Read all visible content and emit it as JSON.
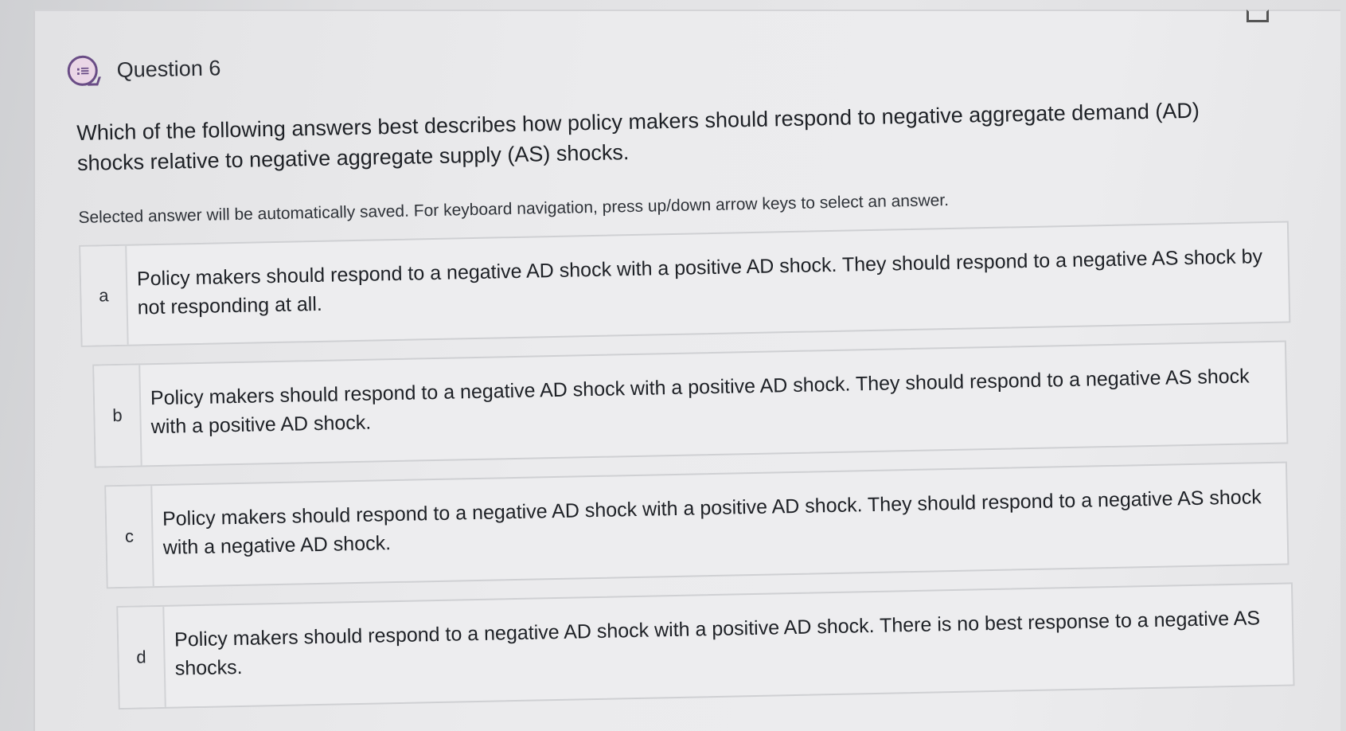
{
  "question": {
    "title": "Question 6",
    "icon": "list-bubble-icon",
    "text": "Which of the following answers best describes how policy makers should respond to negative aggregate demand (AD) shocks relative to negative aggregate supply (AS) shocks.",
    "hint": "Selected answer will be automatically saved. For keyboard navigation, press up/down arrow keys to select an answer."
  },
  "choices": [
    {
      "letter": "a",
      "text": "Policy makers should respond to a negative AD shock with a positive AD shock. They should respond to a negative AS shock by not responding at all."
    },
    {
      "letter": "b",
      "text": "Policy makers should respond to a negative AD shock with a positive AD shock. They should respond to a negative AS shock with a positive AD shock."
    },
    {
      "letter": "c",
      "text": "Policy makers should respond to a negative AD shock with a positive AD shock. They should respond to a negative AS shock with a negative AD shock."
    },
    {
      "letter": "d",
      "text": "Policy makers should respond to a negative AD shock with a positive AD shock. There is no best response to a negative AS shocks."
    }
  ],
  "colors": {
    "icon_accent": "#6a4d86",
    "icon_fill": "#ead6e6"
  }
}
